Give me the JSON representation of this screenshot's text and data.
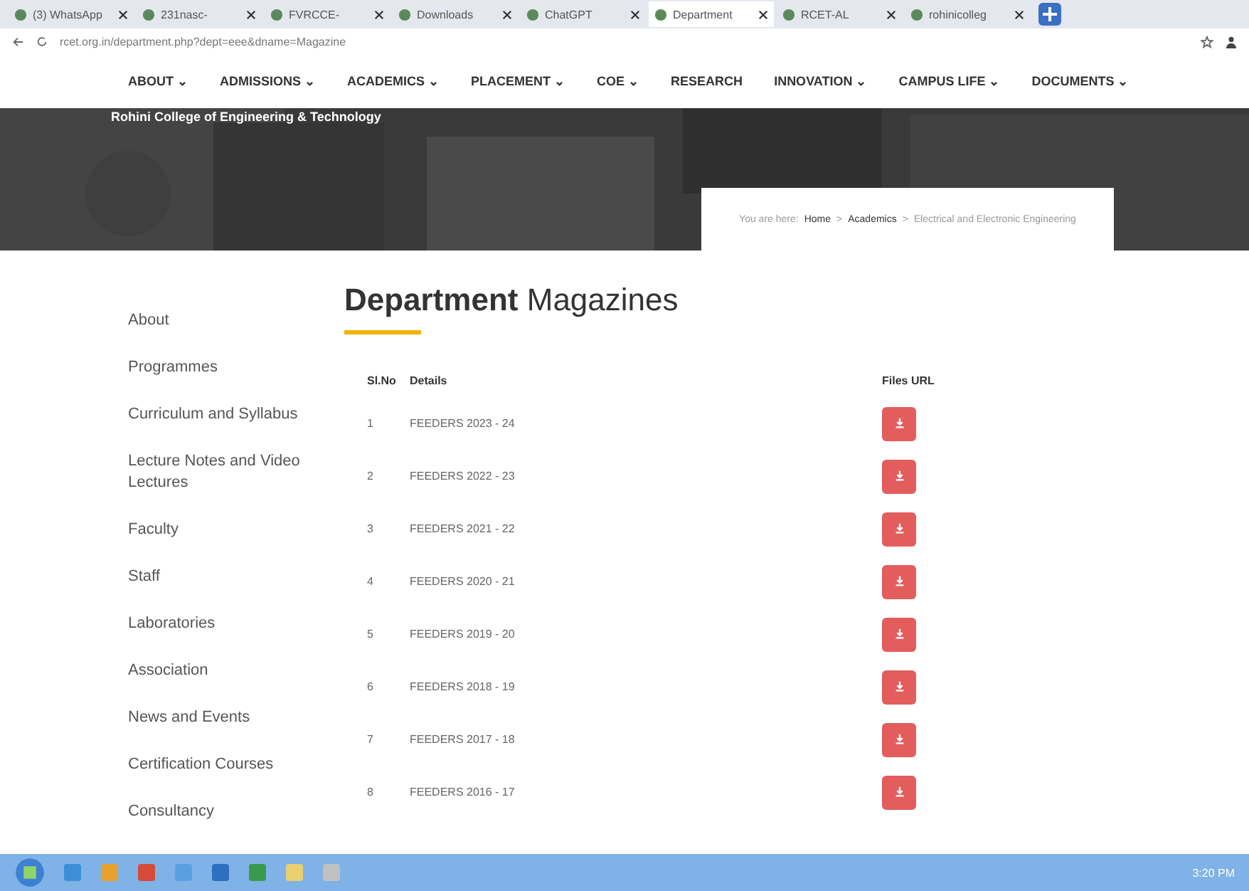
{
  "browser": {
    "tabs": [
      {
        "title": "(3) WhatsApp",
        "selected": false
      },
      {
        "title": "231nasc-",
        "selected": false
      },
      {
        "title": "FVRCCE-",
        "selected": false
      },
      {
        "title": "Downloads",
        "selected": false
      },
      {
        "title": "ChatGPT",
        "selected": false
      },
      {
        "title": "Department",
        "selected": true
      },
      {
        "title": "RCET-AL",
        "selected": false
      },
      {
        "title": "rohinicolleg",
        "selected": false
      }
    ],
    "address": "rcet.org.in/department.php?dept=eee&dname=Magazine"
  },
  "nav": [
    "ABOUT ⌄",
    "ADMISSIONS ⌄",
    "ACADEMICS ⌄",
    "PLACEMENT ⌄",
    "COE ⌄",
    "RESEARCH",
    "INNOVATION ⌄",
    "CAMPUS LIFE ⌄",
    "DOCUMENTS ⌄"
  ],
  "banner": {
    "college": "Rohini College of Engineering & Technology",
    "breadcrumb": {
      "prefix": "You are here:",
      "links": [
        "Home",
        "Academics"
      ],
      "current": "Electrical and Electronic Engineering",
      "separator": ">"
    }
  },
  "sidebar": {
    "items": [
      "About",
      "Programmes",
      "Curriculum and Syllabus",
      "Lecture Notes and Video Lectures",
      "Faculty",
      "Staff",
      "Laboratories",
      "Association",
      "News and Events",
      "Certification Courses",
      "Consultancy"
    ]
  },
  "heading": {
    "bold": "Department",
    "rest": "Magazines"
  },
  "table": {
    "columns": [
      "Sl.No",
      "Details",
      "Files URL"
    ],
    "rows": [
      {
        "no": "1",
        "details": "FEEDERS 2023 - 24"
      },
      {
        "no": "2",
        "details": "FEEDERS 2022 - 23"
      },
      {
        "no": "3",
        "details": "FEEDERS 2021 - 22"
      },
      {
        "no": "4",
        "details": "FEEDERS 2020 - 21"
      },
      {
        "no": "5",
        "details": "FEEDERS 2019 - 20"
      },
      {
        "no": "6",
        "details": "FEEDERS 2018 - 19"
      },
      {
        "no": "7",
        "details": "FEEDERS 2017 - 18"
      },
      {
        "no": "8",
        "details": "FEEDERS 2016 - 17"
      }
    ]
  },
  "taskbar": {
    "clock": "3:20 PM"
  }
}
